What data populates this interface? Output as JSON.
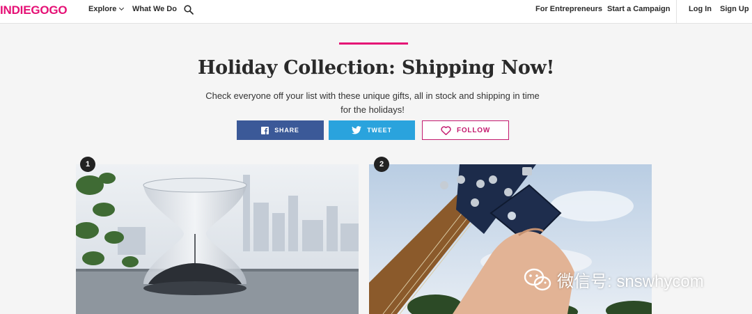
{
  "header": {
    "logo": "INDIEGOGO",
    "explore_label": "Explore",
    "what_we_do_label": "What We Do",
    "for_entrepreneurs_label": "For Entrepreneurs",
    "start_campaign_label": "Start a Campaign",
    "login_label": "Log In",
    "signup_label": "Sign Up"
  },
  "main": {
    "title": "Holiday Collection: Shipping Now!",
    "description": "Check everyone off your list with these unique gifts, all in stock and shipping in time for the holidays!",
    "share_label": "SHARE",
    "tweet_label": "TWEET",
    "follow_label": "FOLLOW"
  },
  "cards": [
    {
      "rank": "1",
      "image": "hourglass-photo"
    },
    {
      "rank": "2",
      "image": "guitar-tuner-photo"
    }
  ],
  "watermark": {
    "text": "微信号: snswhycom"
  },
  "colors": {
    "brand": "#e51075",
    "facebook": "#3b5998",
    "twitter": "#2aa3dd",
    "follow": "#c41a6f"
  }
}
